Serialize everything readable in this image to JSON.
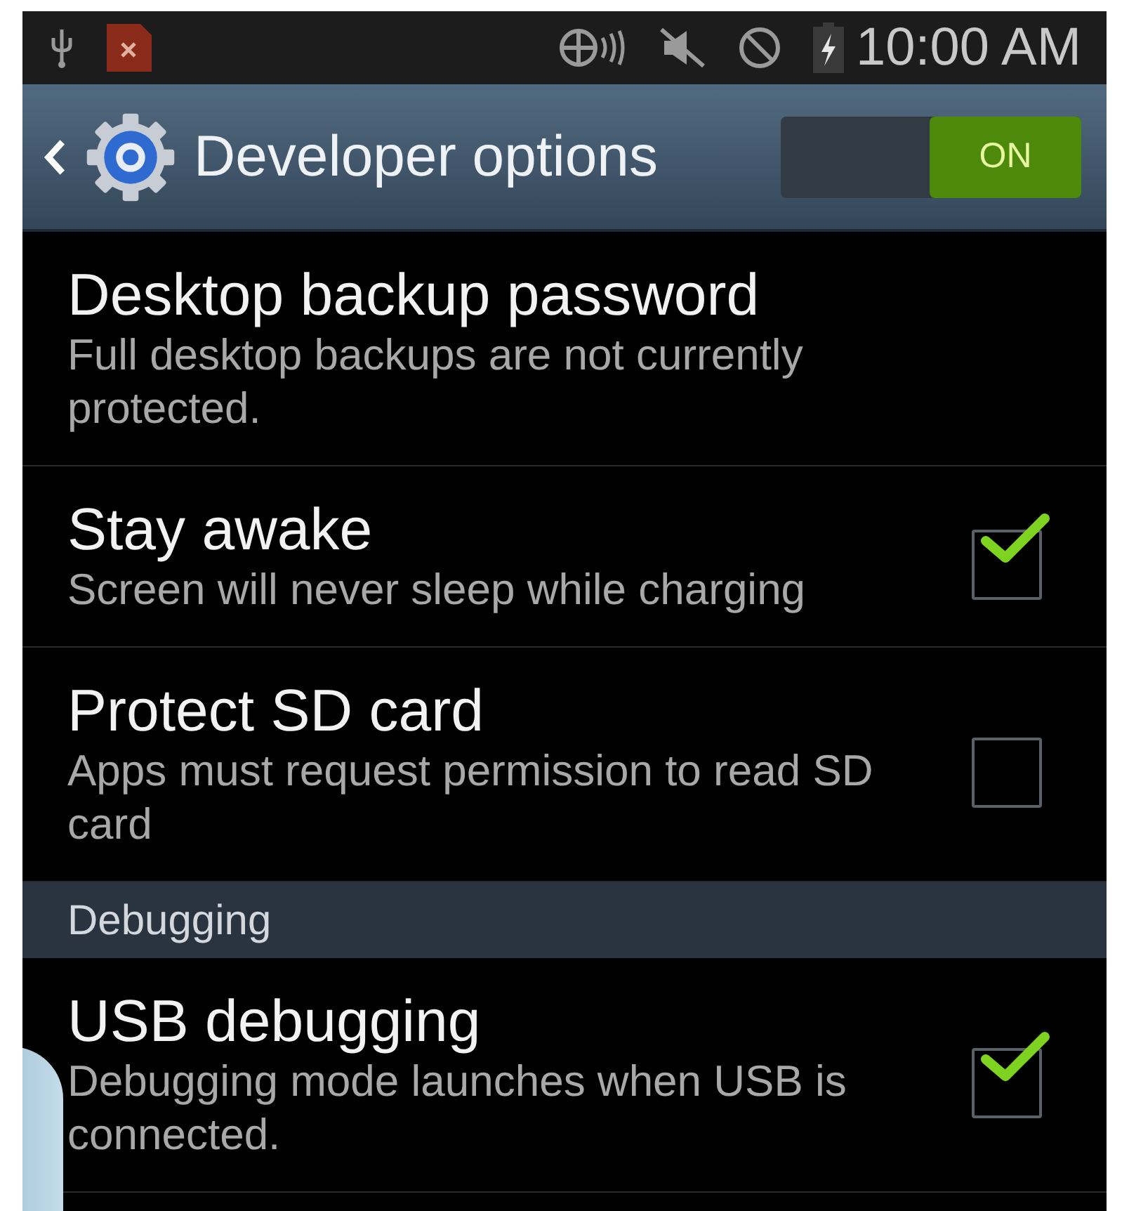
{
  "status_bar": {
    "time": "10:00 AM"
  },
  "header": {
    "title": "Developer options",
    "toggle": {
      "label": "ON",
      "on": true
    }
  },
  "sections": [
    {
      "items": [
        {
          "kind": "plain",
          "title": "Desktop backup password",
          "summary": "Full desktop backups are not currently protected."
        },
        {
          "kind": "checkbox",
          "title": "Stay awake",
          "summary": "Screen will never sleep while charging",
          "checked": true
        },
        {
          "kind": "checkbox",
          "title": "Protect SD card",
          "summary": "Apps must request permission to read SD card",
          "checked": false
        }
      ]
    },
    {
      "title": "Debugging",
      "items": [
        {
          "kind": "checkbox",
          "title": "USB debugging",
          "summary": "Debugging mode launches when USB is connected.",
          "checked": true
        }
      ]
    }
  ]
}
